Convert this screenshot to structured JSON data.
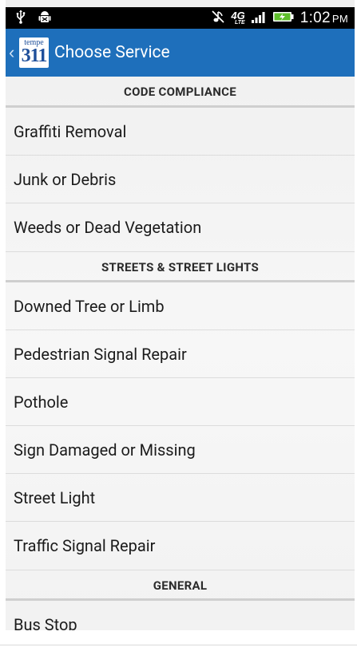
{
  "status_bar": {
    "left_icons": [
      "usb-icon",
      "android-debug-icon"
    ],
    "right_icons": [
      "mute-icon",
      "4g-lte-icon",
      "signal-icon",
      "battery-charging-icon"
    ],
    "network_label": "4G",
    "network_sub": "LTE",
    "time": "1:02",
    "ampm": "PM"
  },
  "action_bar": {
    "back_icon": "chevron-left-icon",
    "logo_top": "tempe",
    "logo_num": "311",
    "title": "Choose Service",
    "color": "#1e6fbb"
  },
  "sections": [
    {
      "header": "CODE COMPLIANCE",
      "items": [
        "Graffiti Removal",
        "Junk or Debris",
        "Weeds or Dead Vegetation"
      ]
    },
    {
      "header": "STREETS & STREET LIGHTS",
      "items": [
        "Downed Tree or Limb",
        "Pedestrian Signal Repair",
        "Pothole",
        "Sign Damaged or Missing",
        "Street Light",
        "Traffic Signal Repair"
      ]
    },
    {
      "header": "GENERAL",
      "items": [
        "Bus Stop"
      ]
    }
  ]
}
